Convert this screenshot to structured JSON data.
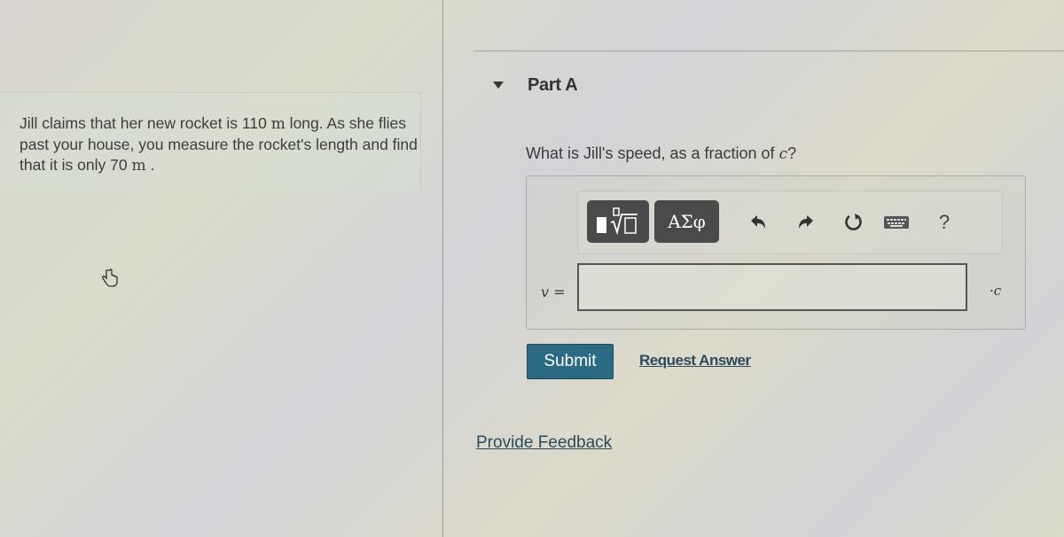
{
  "problem": {
    "text_part1": "Jill claims that her new rocket is 110 ",
    "unit1": "m",
    "text_part2": " long. As she flies past your house, you measure the rocket's length and find that it is only 70 ",
    "unit2": "m",
    "text_part3": " ."
  },
  "part": {
    "title": "Part A",
    "question_prefix": "What is Jill's speed, as a fraction of ",
    "question_var": "c",
    "question_suffix": "?"
  },
  "toolbar": {
    "templates_icon": "fraction-root-templates-icon",
    "greek_label": "ΑΣφ",
    "undo_icon": "undo-icon",
    "redo_icon": "redo-icon",
    "reset_icon": "reset-icon",
    "keyboard_icon": "keyboard-icon",
    "help_label": "?"
  },
  "answer": {
    "variable_label": "v =",
    "input_value": "",
    "unit_suffix": "·c"
  },
  "actions": {
    "submit_label": "Submit",
    "request_answer_label": "Request Answer",
    "feedback_label": "Provide Feedback"
  },
  "colors": {
    "submit_bg": "#2b6a82",
    "link": "#2c4a5e"
  }
}
